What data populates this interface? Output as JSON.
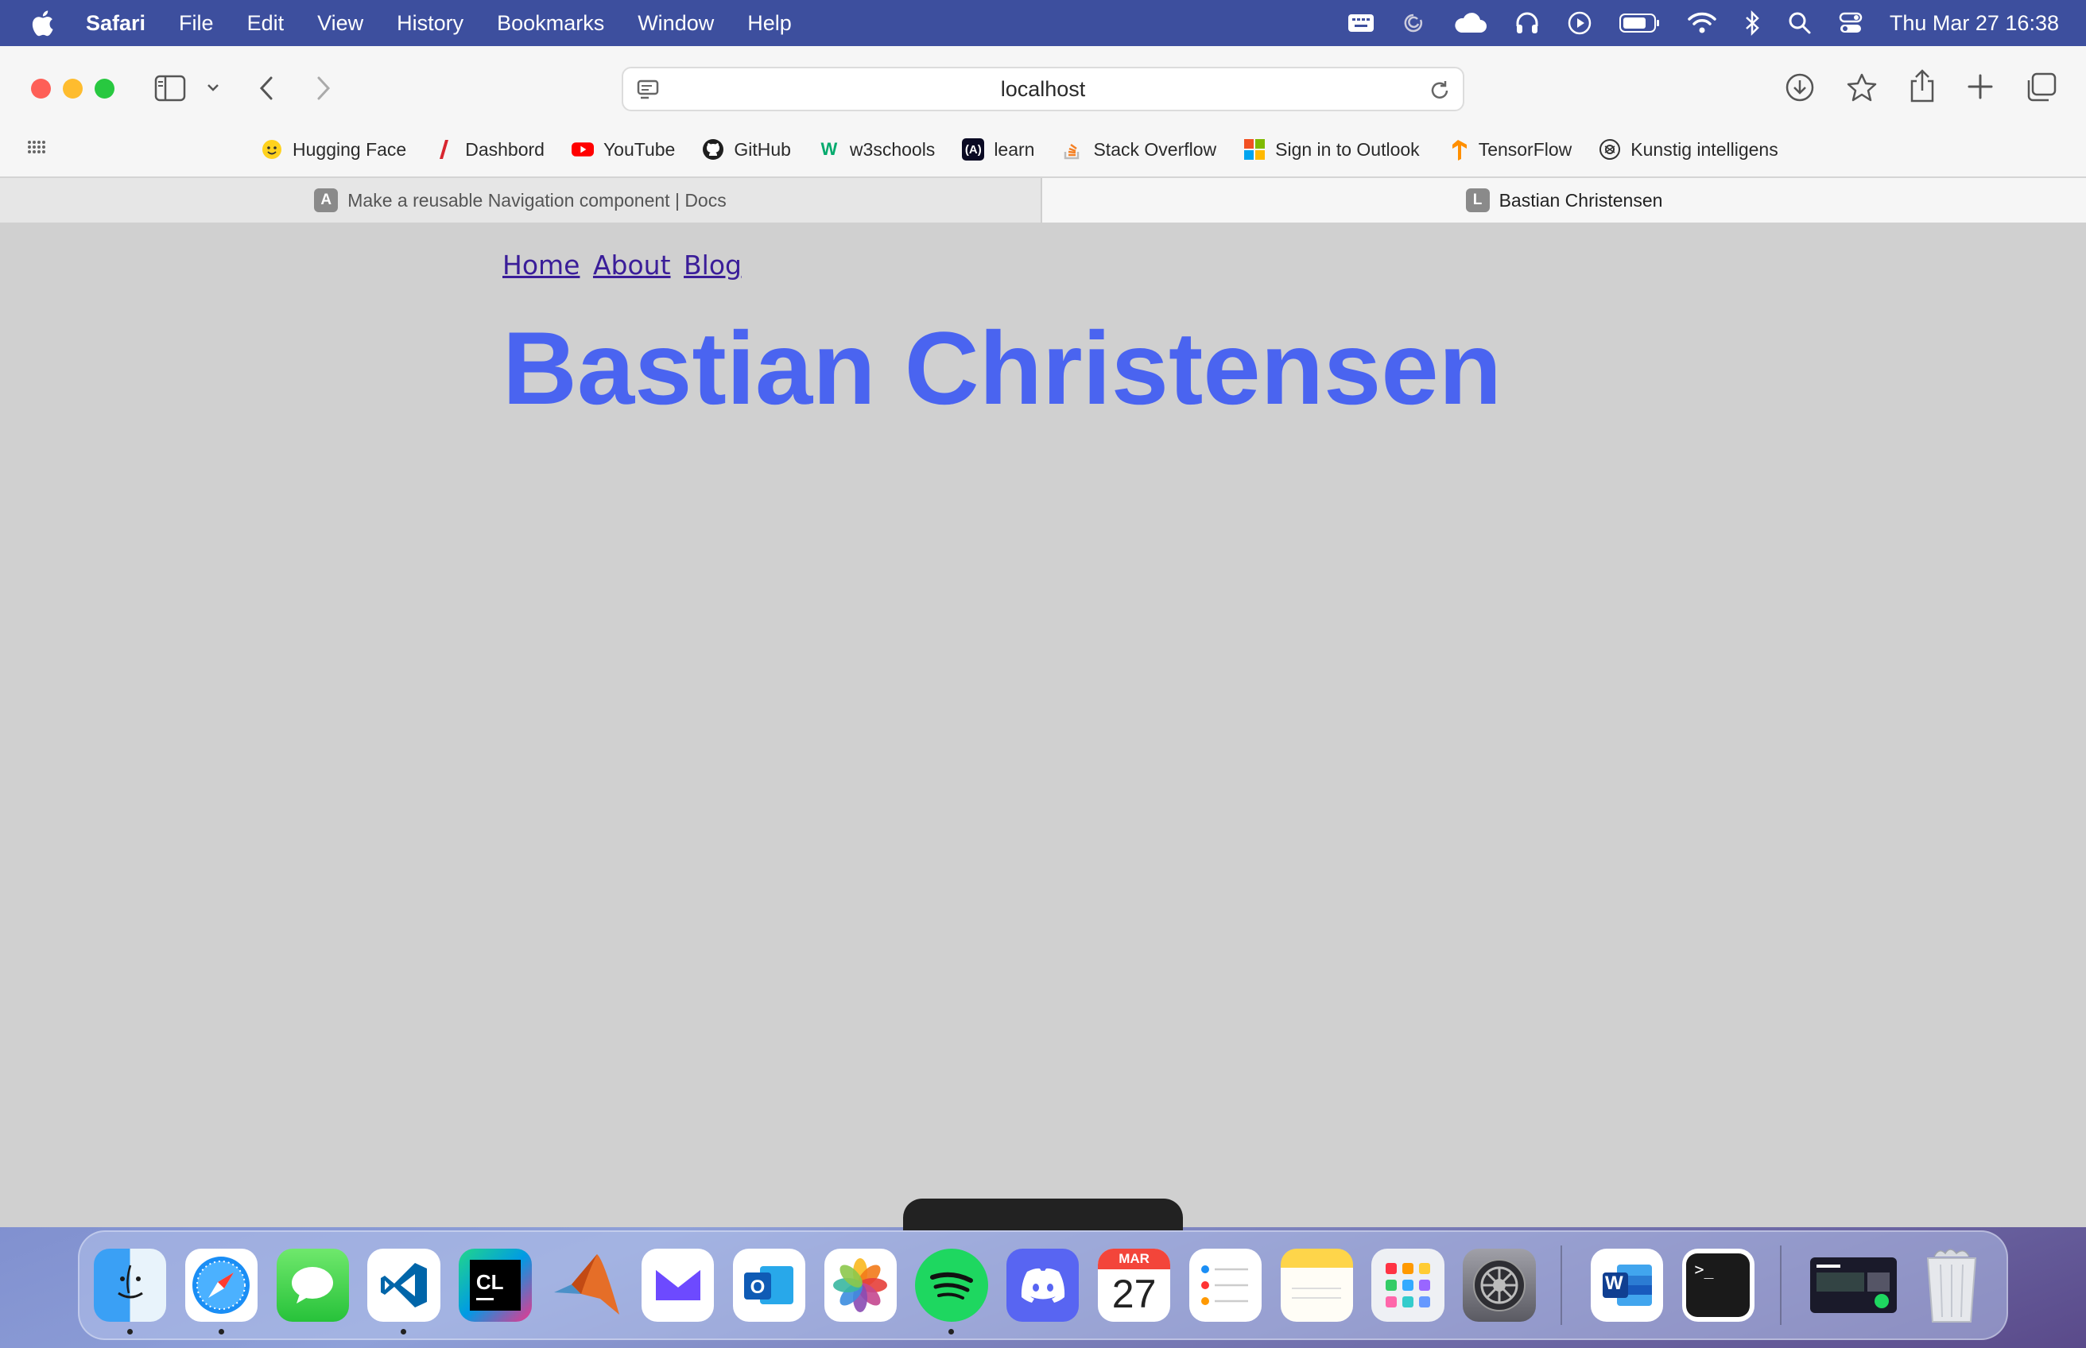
{
  "menubar": {
    "app_name": "Safari",
    "items": [
      "File",
      "Edit",
      "View",
      "History",
      "Bookmarks",
      "Window",
      "Help"
    ],
    "clock": "Thu Mar 27  16:38"
  },
  "browser": {
    "url": "localhost",
    "bookmarks": [
      {
        "label": "Hugging Face",
        "icon": "hugging-face-icon"
      },
      {
        "label": "Dashbord",
        "icon": "dashbord-icon"
      },
      {
        "label": "YouTube",
        "icon": "youtube-icon"
      },
      {
        "label": "GitHub",
        "icon": "github-icon"
      },
      {
        "label": "w3schools",
        "icon": "w3schools-icon"
      },
      {
        "label": "learn",
        "icon": "learn-icon"
      },
      {
        "label": "Stack Overflow",
        "icon": "stack-overflow-icon"
      },
      {
        "label": "Sign in to Outlook",
        "icon": "microsoft-icon"
      },
      {
        "label": "TensorFlow",
        "icon": "tensorflow-icon"
      },
      {
        "label": "Kunstig intelligens",
        "icon": "openai-icon"
      }
    ],
    "tabs": [
      {
        "label": "Make a reusable Navigation component | Docs",
        "favicon": "A",
        "active": false
      },
      {
        "label": "Bastian Christensen",
        "favicon": "L",
        "active": true
      }
    ]
  },
  "page": {
    "nav": [
      "Home",
      "About",
      "Blog"
    ],
    "heading": "Bastian Christensen"
  },
  "dock": {
    "calendar_month": "MAR",
    "calendar_day": "27",
    "clion_label": "CL",
    "word_label": "W",
    "terminal_label": ">_"
  },
  "colors": {
    "heading": "#4a64f0",
    "link": "#3a1d99",
    "page_bg": "#d0d0d0",
    "menubar_bg": "#3d4f9e"
  }
}
